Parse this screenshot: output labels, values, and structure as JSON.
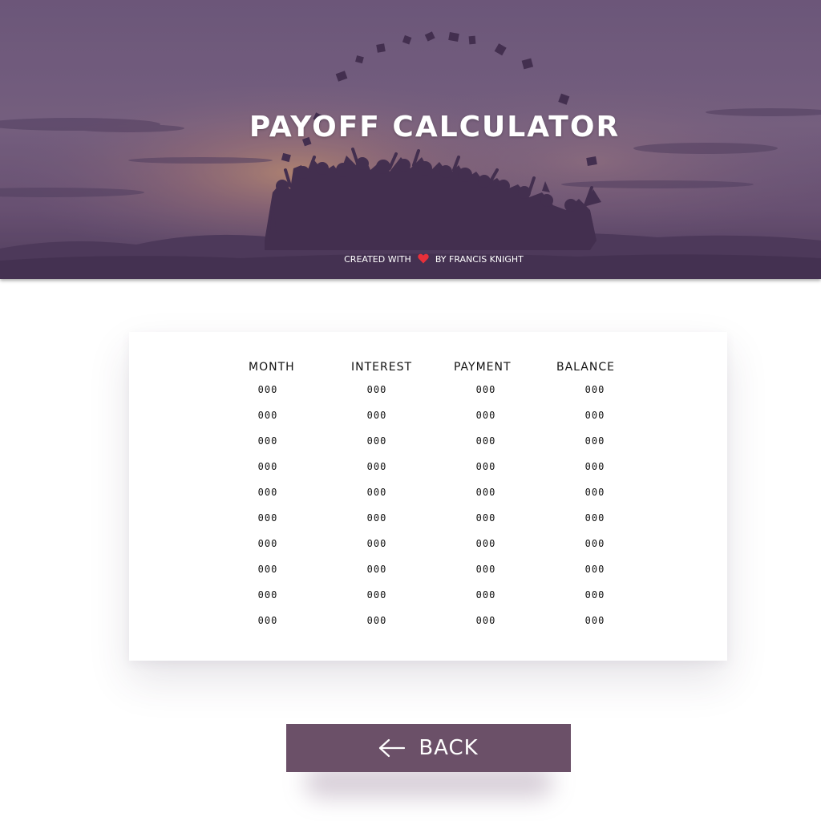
{
  "header": {
    "title": "PAYOFF CALCULATOR",
    "credit_prefix": "CREATED WITH",
    "credit_suffix": "BY FRANCIS KNIGHT",
    "heart_icon": "heart-icon",
    "overlay_color": "#5e4a6e"
  },
  "table": {
    "columns": [
      "MONTH",
      "INTEREST",
      "PAYMENT",
      "BALANCE"
    ],
    "rows": [
      [
        "000",
        "000",
        "000",
        "000"
      ],
      [
        "000",
        "000",
        "000",
        "000"
      ],
      [
        "000",
        "000",
        "000",
        "000"
      ],
      [
        "000",
        "000",
        "000",
        "000"
      ],
      [
        "000",
        "000",
        "000",
        "000"
      ],
      [
        "000",
        "000",
        "000",
        "000"
      ],
      [
        "000",
        "000",
        "000",
        "000"
      ],
      [
        "000",
        "000",
        "000",
        "000"
      ],
      [
        "000",
        "000",
        "000",
        "000"
      ],
      [
        "000",
        "000",
        "000",
        "000"
      ]
    ]
  },
  "back_button": {
    "label": "BACK",
    "icon": "arrow-left-icon",
    "color": "#6b5068"
  }
}
